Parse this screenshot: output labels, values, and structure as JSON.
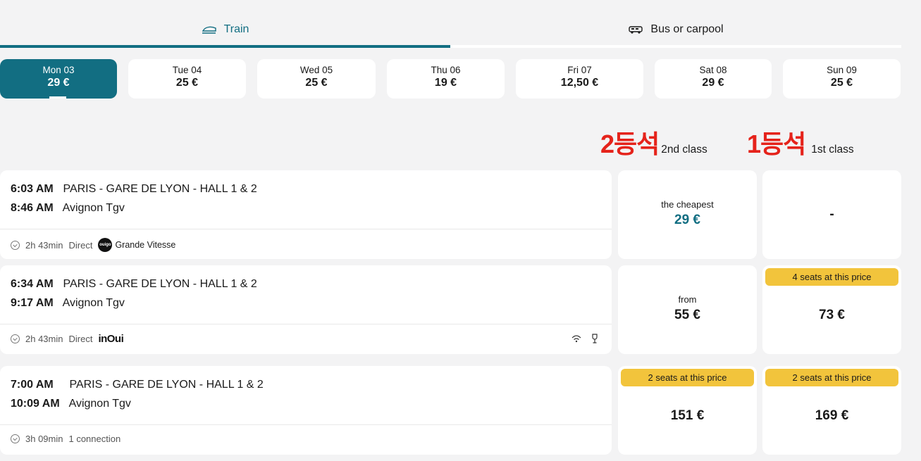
{
  "tabs": {
    "train": "Train",
    "bus": "Bus or carpool"
  },
  "dates": [
    {
      "day": "Mon 03",
      "price": "29 €"
    },
    {
      "day": "Tue 04",
      "price": "25 €"
    },
    {
      "day": "Wed 05",
      "price": "25 €"
    },
    {
      "day": "Thu 06",
      "price": "19 €"
    },
    {
      "day": "Fri 07",
      "price": "12,50 €"
    },
    {
      "day": "Sat 08",
      "price": "29 €"
    },
    {
      "day": "Sun 09",
      "price": "25 €"
    }
  ],
  "classes": {
    "second_ko": "2등석",
    "second_en": "2nd class",
    "first_ko": "1등석",
    "first_en": "1st class"
  },
  "trips": [
    {
      "dep_time": "6:03 AM",
      "dep_station": "PARIS - GARE DE LYON - HALL 1 & 2",
      "arr_time": "8:46 AM",
      "arr_station": "Avignon Tgv",
      "duration": "2h 43min",
      "type": "Direct",
      "logo_text": "ouigo",
      "operator": "Grande Vitesse",
      "second": {
        "label": "the cheapest",
        "price": "29 €"
      },
      "first": {
        "price": "-"
      }
    },
    {
      "dep_time": "6:34 AM",
      "dep_station": "PARIS - GARE DE LYON - HALL 1 & 2",
      "arr_time": "9:17 AM",
      "arr_station": "Avignon Tgv",
      "duration": "2h 43min",
      "type": "Direct",
      "operator": "inOui",
      "second": {
        "label": "from",
        "price": "55 €"
      },
      "first": {
        "badge": "4 seats at this price",
        "price": "73 €"
      }
    },
    {
      "dep_time": "7:00 AM",
      "dep_station": "PARIS - GARE DE LYON - HALL 1 & 2",
      "arr_time": "10:09 AM",
      "arr_station": "Avignon Tgv",
      "duration": "3h 09min",
      "type": "1 connection",
      "second": {
        "badge": "2 seats at this price",
        "price": "151 €"
      },
      "first": {
        "badge": "2 seats at this price",
        "price": "169 €"
      }
    }
  ],
  "icons": {
    "train": "train-icon",
    "bus": "bus-icon",
    "clock": "clock-icon",
    "wifi": "wifi-icon",
    "bar": "bar-icon"
  },
  "colors": {
    "accent": "#126e82",
    "badge": "#f2c43c",
    "annotation": "#e5231b"
  }
}
